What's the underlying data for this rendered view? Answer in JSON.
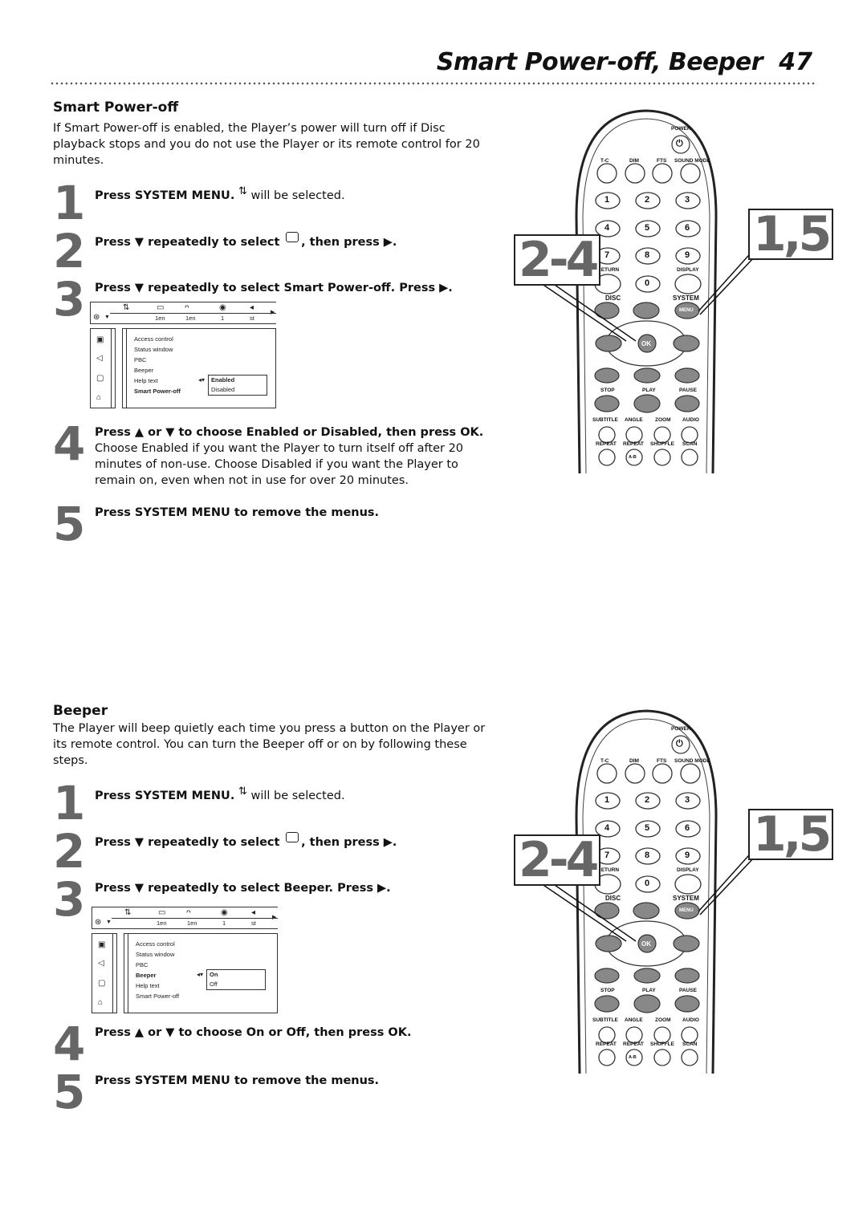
{
  "header": {
    "title": "Smart Power-off, Beeper",
    "page_number": "47"
  },
  "sections": [
    {
      "title": "Smart Power-off",
      "intro": "If Smart Power-off is enabled, the Player’s power will turn off if Disc playback stops and you do not use the Player or its remote control for 20 minutes.",
      "steps": [
        {
          "num": "1",
          "bold": "Press SYSTEM MENU.",
          "icon": "system-menu-icon",
          "rest": "will be selected."
        },
        {
          "num": "2",
          "bold_a": "Press ▼ repeatedly to select",
          "icon": "preferences-icon",
          "bold_b": ", then press ▶."
        },
        {
          "num": "3",
          "bold": "Press ▼ repeatedly to select Smart Power-off. Press ▶."
        },
        {
          "num": "4",
          "bold": "Press ▲ or ▼ to choose Enabled or Disabled, then press OK.",
          "rest": "Choose Enabled if you want the Player to turn itself off after 20 minutes of non-use. Choose Disabled if you want the Player to remain on, even when not in use for over 20 minutes."
        },
        {
          "num": "5",
          "bold": "Press SYSTEM MENU to remove the menus."
        }
      ],
      "osd": {
        "top_values": [
          "1en",
          "1en",
          "1",
          "st"
        ],
        "items": [
          "Access control",
          "Status window",
          "PBC",
          "Beeper",
          "Help text",
          "Smart Power-off"
        ],
        "selected_item": "Smart Power-off",
        "options": [
          "Enabled",
          "Disabled"
        ],
        "selected_option": "Enabled"
      },
      "callouts": {
        "left": "2-4",
        "right": "1,5"
      }
    },
    {
      "title": "Beeper",
      "intro": "The Player will beep quietly each time you press a button on the Player or its remote control. You can turn the Beeper off or on by following these steps.",
      "steps": [
        {
          "num": "1",
          "bold": "Press SYSTEM MENU.",
          "icon": "system-menu-icon",
          "rest": "will be selected."
        },
        {
          "num": "2",
          "bold_a": "Press ▼ repeatedly to select",
          "icon": "preferences-icon",
          "bold_b": ", then press ▶."
        },
        {
          "num": "3",
          "bold": "Press ▼ repeatedly to select Beeper. Press ▶."
        },
        {
          "num": "4",
          "bold": "Press ▲ or ▼ to choose On or Off, then press OK."
        },
        {
          "num": "5",
          "bold": "Press SYSTEM MENU to remove the menus."
        }
      ],
      "osd": {
        "top_values": [
          "1en",
          "1en",
          "1",
          "st"
        ],
        "items": [
          "Access control",
          "Status window",
          "PBC",
          "Beeper",
          "Help text",
          "Smart Power-off"
        ],
        "selected_item": "Beeper",
        "options": [
          "On",
          "Off"
        ],
        "selected_option": "On"
      },
      "callouts": {
        "left": "2-4",
        "right": "1,5"
      }
    }
  ],
  "remote": {
    "power_label": "POWER",
    "top_row": [
      "T-C",
      "DIM",
      "FTS",
      "SOUND MODE"
    ],
    "digits": [
      "1",
      "2",
      "3",
      "4",
      "5",
      "6",
      "7",
      "8",
      "9",
      "0"
    ],
    "return_label": "RETURN",
    "display_label": "DISPLAY",
    "disc_label": "DISC",
    "system_label": "SYSTEM",
    "menu_label": "MENU",
    "ok_label": "OK",
    "transport_labels": [
      "STOP",
      "PLAY",
      "PAUSE"
    ],
    "row_a": [
      "SUBTITLE",
      "ANGLE",
      "ZOOM",
      "AUDIO"
    ],
    "row_b": [
      "REPEAT",
      "REPEAT",
      "SHUFFLE",
      "SCAN"
    ],
    "ab_label": "A-B"
  }
}
